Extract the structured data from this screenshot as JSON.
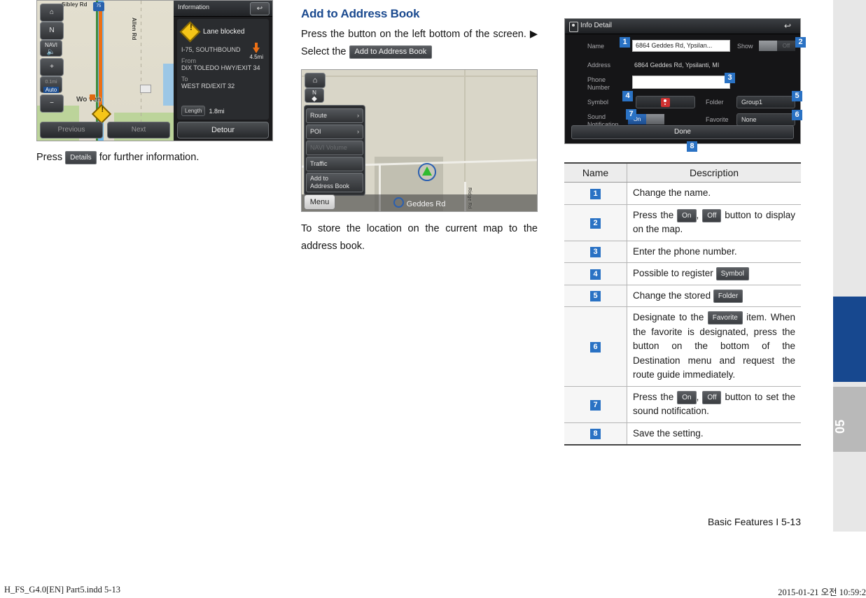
{
  "left_figure": {
    "map_buttons": [
      {
        "name": "home-icon",
        "label": "⌂"
      },
      {
        "name": "north-up-icon",
        "label": "N"
      },
      {
        "name": "navi-volume-icon",
        "label": "NAVI"
      },
      {
        "name": "zoom-in-icon",
        "label": "+"
      },
      {
        "name": "map-scale-auto",
        "label": "Auto"
      },
      {
        "name": "zoom-out-icon",
        "label": "−"
      }
    ],
    "map_labels": [
      "Sibley Rd",
      "Allen Rd",
      "Wo      ven"
    ],
    "route_shield": "75",
    "bottom_buttons": [
      "Previous",
      "Next"
    ],
    "info_panel": {
      "title": "Information",
      "back_icon": "↩",
      "alert": "Lane blocked",
      "highway": "I-75, SOUTHBOUND",
      "distance": "4.5mi",
      "from_label": "From",
      "from_value": "DIX TOLEDO HWY/EXIT 34",
      "to_label": "To",
      "to_value": "WEST RD/EXIT 32",
      "length_label": "Length",
      "length_value": "1.8mi",
      "detour": "Detour"
    }
  },
  "left_caption": {
    "before": "Press ",
    "button": "Details",
    "after": " for further information."
  },
  "middle": {
    "heading": "Add to Address Book",
    "para_1a": "Press the button on the left bottom of the screen. ▶ Select the ",
    "para_1_button": "Add to Address Book",
    "para_2": "To store the location on the current map to the address book.",
    "figure": {
      "home_icon": "⌂",
      "compass_icon": "N",
      "menu_items": [
        {
          "label": "Route",
          "chevron": "›",
          "dim": false
        },
        {
          "label": "POI",
          "chevron": "›",
          "dim": false
        },
        {
          "label": "NAVI Volume",
          "chevron": "",
          "dim": true
        },
        {
          "label": "Traffic",
          "chevron": "",
          "dim": false
        },
        {
          "label": "Add to\nAddress Book",
          "chevron": "",
          "dim": false
        }
      ],
      "menu_button": "Menu",
      "street_name": "Geddes Rd",
      "side_street": "Ridge Rd"
    }
  },
  "info_detail": {
    "title": "Info Detail",
    "back_icon": "↩",
    "fields": {
      "name_label": "Name",
      "name_value": "6864 Geddes Rd, Ypsilan...",
      "show_label": "Show",
      "show_on": "On",
      "show_off": "Off",
      "address_label": "Address",
      "address_value": "6864 Geddes Rd, Ypsilanti, MI",
      "phone_label": "Phone\nNumber",
      "phone_value": "",
      "symbol_label": "Symbol",
      "folder_label": "Folder",
      "folder_value": "Group1",
      "sound_label": "Sound\nNotification",
      "sound_on": "On",
      "sound_off": "Off",
      "favorite_label": "Favorite",
      "favorite_value": "None",
      "done": "Done"
    },
    "callouts": [
      "1",
      "2",
      "3",
      "4",
      "5",
      "6",
      "7",
      "8"
    ]
  },
  "table": {
    "headers": [
      "Name",
      "Description"
    ],
    "rows": [
      {
        "num": "1",
        "parts": [
          {
            "t": "text",
            "v": "Change the name."
          }
        ]
      },
      {
        "num": "2",
        "parts": [
          {
            "t": "text",
            "v": "Press the "
          },
          {
            "t": "btn",
            "v": "On"
          },
          {
            "t": "text",
            "v": ", "
          },
          {
            "t": "btn",
            "v": "Off"
          },
          {
            "t": "text",
            "v": " button to display on the map."
          }
        ]
      },
      {
        "num": "3",
        "parts": [
          {
            "t": "text",
            "v": "Enter the phone number."
          }
        ]
      },
      {
        "num": "4",
        "parts": [
          {
            "t": "text",
            "v": "Possible to register "
          },
          {
            "t": "btn",
            "v": "Symbol"
          }
        ]
      },
      {
        "num": "5",
        "parts": [
          {
            "t": "text",
            "v": "Change the stored "
          },
          {
            "t": "btn",
            "v": "Folder"
          }
        ]
      },
      {
        "num": "6",
        "parts": [
          {
            "t": "text",
            "v": "Designate to the "
          },
          {
            "t": "btn",
            "v": "Favorite"
          },
          {
            "t": "text",
            "v": " item. When the favorite is designated, press the button on the bottom of the Destination menu and request the route guide immediately."
          }
        ]
      },
      {
        "num": "7",
        "parts": [
          {
            "t": "text",
            "v": "Press the "
          },
          {
            "t": "btn",
            "v": "On"
          },
          {
            "t": "text",
            "v": ", "
          },
          {
            "t": "btn",
            "v": "Off"
          },
          {
            "t": "text",
            "v": " button to set the sound notification."
          }
        ]
      },
      {
        "num": "8",
        "parts": [
          {
            "t": "text",
            "v": "Save the setting."
          }
        ]
      }
    ]
  },
  "edge_tab": {
    "number": "05",
    "blue": "#17488f",
    "gray": "#b9b9b9"
  },
  "page_label": "Basic Features I 5-13",
  "footer_left": "H_FS_G4.0[EN] Part5.indd   5-13",
  "footer_right": "2015-01-21   오전 10:59:2"
}
